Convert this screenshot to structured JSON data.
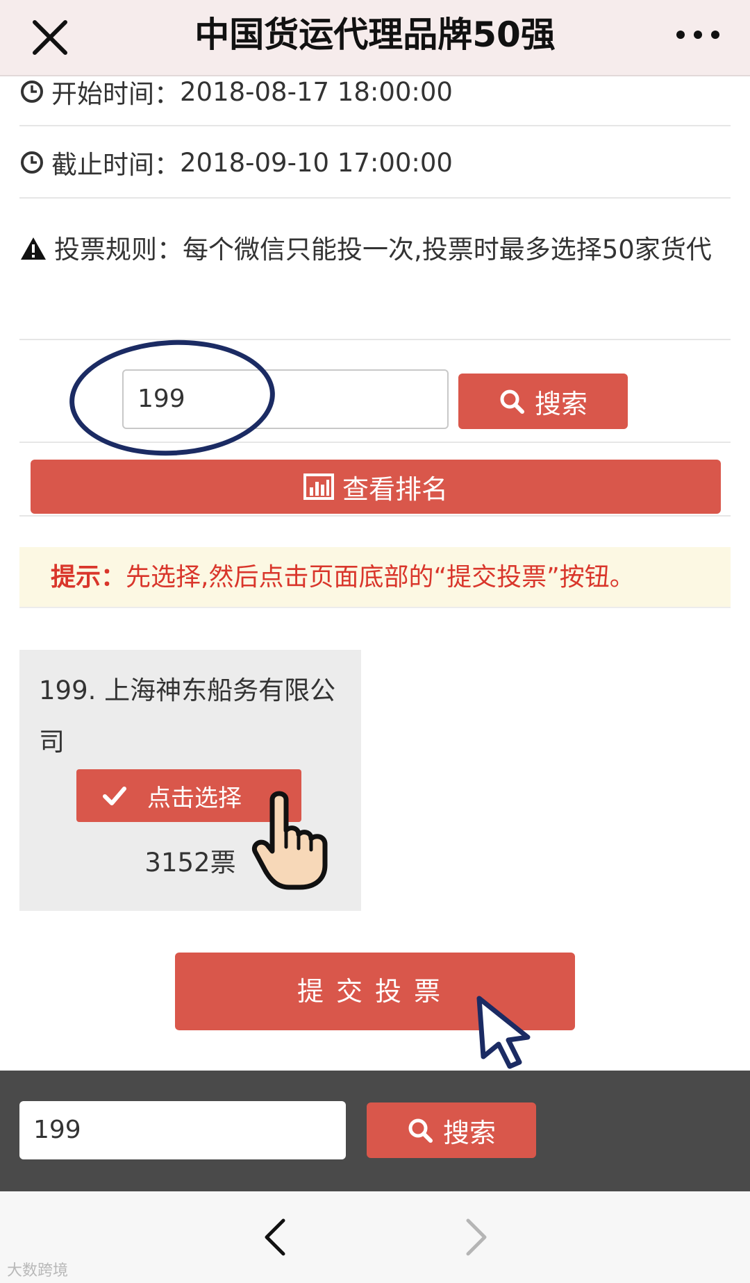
{
  "header": {
    "title": "中国货运代理品牌50强"
  },
  "info": {
    "start_label": "开始时间：",
    "start_value": "2018-08-17 18:00:00",
    "end_label": "截止时间：",
    "end_value": "2018-09-10 17:00:00",
    "rule_label": "投票规则：",
    "rule_value": "每个微信只能投一次,投票时最多选择50家货代"
  },
  "search": {
    "value": "199",
    "button_label": "搜索"
  },
  "rank_button_label": "查看排名",
  "tip": {
    "label": "提示：",
    "text": "先选择,然后点击页面底部的“提交投票”按钮。"
  },
  "candidate": {
    "name": "199. 上海神东船务有限公司",
    "select_label": "点击选择",
    "votes": "3152票"
  },
  "submit_label": "提交投票",
  "bottom_search": {
    "value": "199",
    "button_label": "搜索"
  },
  "watermark": "大数跨境",
  "colors": {
    "accent": "#d9574b",
    "tip_text": "#d9362b",
    "tip_bg": "#fcf8e3",
    "annotation": "#1b2b63"
  }
}
